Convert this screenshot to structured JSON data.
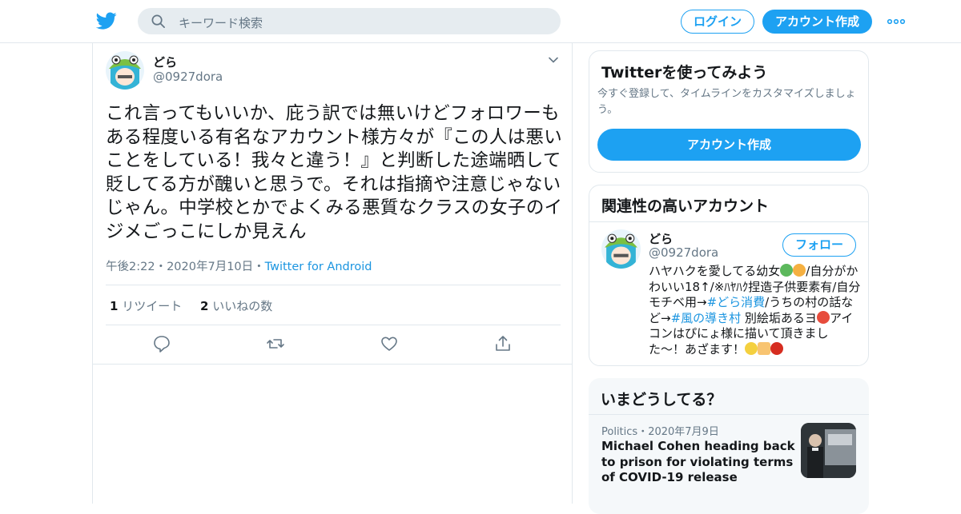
{
  "header": {
    "logo_icon": "twitter-bird-icon",
    "search_placeholder": "キーワード検索",
    "login_label": "ログイン",
    "signup_label": "アカウント作成",
    "more_icon": "more-dots-icon"
  },
  "tweet": {
    "display_name": "どら",
    "handle": "@0927dora",
    "text": "これ言ってもいいか、庇う訳では無いけどフォロワーもある程度いる有名なアカウント様方々が『この人は悪いことをしている！我々と違う！』と判断した途端晒して貶してる方が醜いと思うで。それは指摘や注意じゃないじゃん。中学校とかでよくみる悪質なクラスの女子のイジメごっこにしか見えん",
    "time": "午後2:22",
    "date": "2020年7月10日",
    "sep": "・",
    "source": "Twitter for Android",
    "retweets_count": "1",
    "retweets_label": "リツイート",
    "likes_count": "2",
    "likes_label": "いいねの数"
  },
  "sidebar": {
    "try": {
      "title": "Twitterを使ってみよう",
      "subtitle": "今すぐ登録して、タイムラインをカスタマイズしましょう。",
      "button": "アカウント作成"
    },
    "related": {
      "title": "関連性の高いアカウント",
      "name": "どら",
      "handle": "@0927dora",
      "follow": "フォロー",
      "bio_1": "ハヤハクを愛してる幼女",
      "bio_2": "/自分がかわいい18↑/※ﾊﾔﾊｸ捏造子供要素有/自分モチベ用→",
      "bio_tag1": "#どら消費",
      "bio_3": "/うちの村の話など→",
      "bio_tag2": "#風の導き村",
      "bio_4": " 別絵垢あるヨ",
      "bio_5": "アイコンはぴにょ様に描いて頂きました〜！あざます！"
    },
    "trends": {
      "title": "いまどうしてる？",
      "category": "Politics",
      "sep": "・",
      "date": "2020年7月9日",
      "headline": "Michael Cohen heading back to prison for violating terms of COVID-19 release"
    }
  }
}
